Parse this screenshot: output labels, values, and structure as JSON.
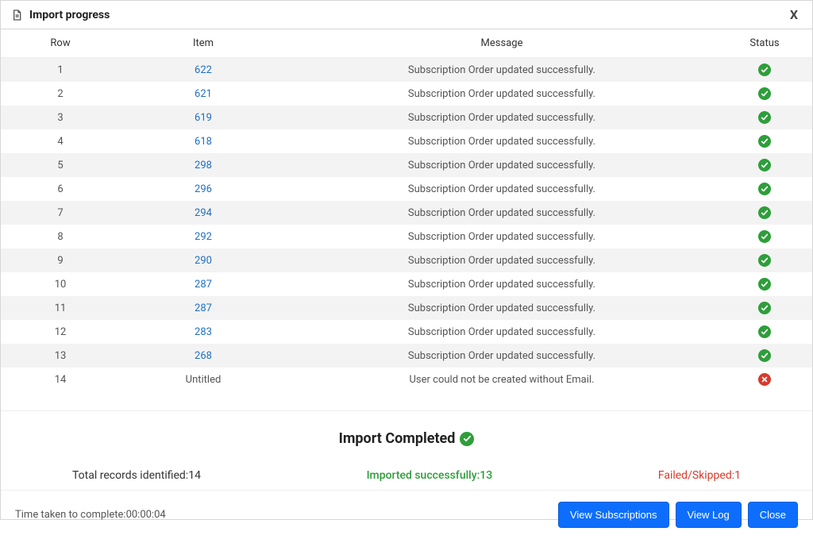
{
  "modal": {
    "title": "Import progress",
    "close_label": "X"
  },
  "table": {
    "headers": {
      "row": "Row",
      "item": "Item",
      "message": "Message",
      "status": "Status"
    },
    "rows": [
      {
        "row": "1",
        "item": "622",
        "item_link": true,
        "message": "Subscription Order updated successfully.",
        "status": "ok"
      },
      {
        "row": "2",
        "item": "621",
        "item_link": true,
        "message": "Subscription Order updated successfully.",
        "status": "ok"
      },
      {
        "row": "3",
        "item": "619",
        "item_link": true,
        "message": "Subscription Order updated successfully.",
        "status": "ok"
      },
      {
        "row": "4",
        "item": "618",
        "item_link": true,
        "message": "Subscription Order updated successfully.",
        "status": "ok"
      },
      {
        "row": "5",
        "item": "298",
        "item_link": true,
        "message": "Subscription Order updated successfully.",
        "status": "ok"
      },
      {
        "row": "6",
        "item": "296",
        "item_link": true,
        "message": "Subscription Order updated successfully.",
        "status": "ok"
      },
      {
        "row": "7",
        "item": "294",
        "item_link": true,
        "message": "Subscription Order updated successfully.",
        "status": "ok"
      },
      {
        "row": "8",
        "item": "292",
        "item_link": true,
        "message": "Subscription Order updated successfully.",
        "status": "ok"
      },
      {
        "row": "9",
        "item": "290",
        "item_link": true,
        "message": "Subscription Order updated successfully.",
        "status": "ok"
      },
      {
        "row": "10",
        "item": "287",
        "item_link": true,
        "message": "Subscription Order updated successfully.",
        "status": "ok"
      },
      {
        "row": "11",
        "item": "287",
        "item_link": true,
        "message": "Subscription Order updated successfully.",
        "status": "ok"
      },
      {
        "row": "12",
        "item": "283",
        "item_link": true,
        "message": "Subscription Order updated successfully.",
        "status": "ok"
      },
      {
        "row": "13",
        "item": "268",
        "item_link": true,
        "message": "Subscription Order updated successfully.",
        "status": "ok"
      },
      {
        "row": "14",
        "item": "Untitled",
        "item_link": false,
        "message": "User could not be created without Email.",
        "status": "err"
      }
    ]
  },
  "summary": {
    "heading": "Import Completed",
    "total_label": "Total records identified:",
    "total_value": "14",
    "imported_label": "Imported successfully:",
    "imported_value": "13",
    "failed_label": "Failed/Skipped:",
    "failed_value": "1"
  },
  "footer": {
    "time_label": "Time taken to complete:",
    "time_value": "00:00:04",
    "buttons": {
      "view_subscriptions": "View Subscriptions",
      "view_log": "View Log",
      "close": "Close"
    }
  },
  "colors": {
    "link": "#1f70c1",
    "success": "#2e9e3a",
    "error": "#d83a2b",
    "primary": "#0d6efd"
  }
}
